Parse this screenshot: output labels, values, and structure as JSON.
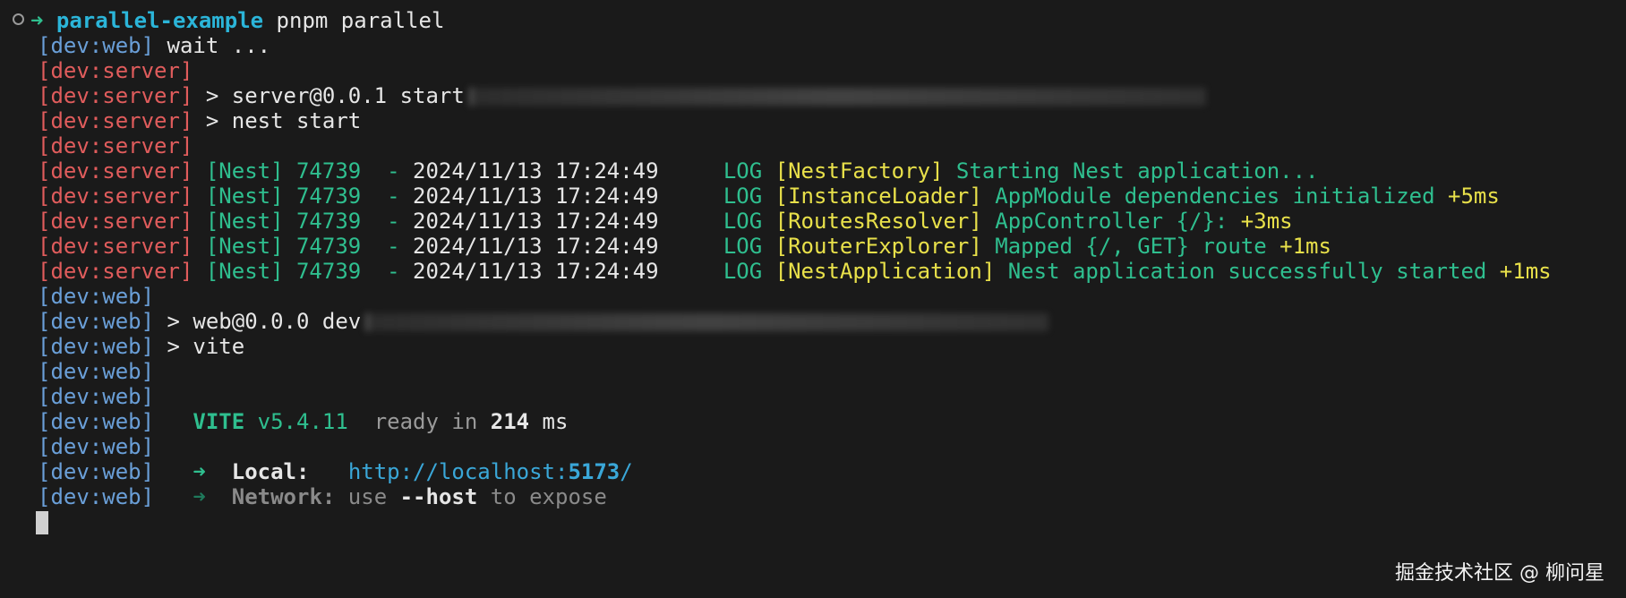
{
  "prompt": {
    "arrow": "➜",
    "dir": "parallel-example",
    "command": "pnpm parallel",
    "dir_color": "#2bb5d9",
    "arrow_color": "#2fbf8f"
  },
  "colors": {
    "web_prefix": "#6a9fd8",
    "server_prefix": "#e05c5c",
    "nest_green": "#2fbf8f",
    "context_yellow": "#e8e04a",
    "url_blue": "#3aa7d8",
    "dim": "#8a8a8a"
  },
  "lines": [
    {
      "kind": "text",
      "segments": [
        {
          "text": "[dev:web]",
          "color": "#6a9fd8"
        },
        {
          "text": " wait ...",
          "color": "#e6e6e6"
        }
      ]
    },
    {
      "kind": "text",
      "segments": [
        {
          "text": "[dev:server]",
          "color": "#e05c5c"
        }
      ]
    },
    {
      "kind": "text",
      "blur": "server",
      "segments": [
        {
          "text": "[dev:server]",
          "color": "#e05c5c"
        },
        {
          "text": " > server@0.0.1 start",
          "color": "#e6e6e6"
        }
      ]
    },
    {
      "kind": "text",
      "segments": [
        {
          "text": "[dev:server]",
          "color": "#e05c5c"
        },
        {
          "text": " > nest start",
          "color": "#e6e6e6"
        }
      ]
    },
    {
      "kind": "text",
      "segments": [
        {
          "text": "[dev:server]",
          "color": "#e05c5c"
        }
      ]
    },
    {
      "kind": "text",
      "segments": [
        {
          "text": "[dev:server]",
          "color": "#e05c5c"
        },
        {
          "text": " [Nest] 74739  - ",
          "color": "#2fbf8f"
        },
        {
          "text": "2024/11/13 17:24:49",
          "color": "#e6e6e6"
        },
        {
          "text": "     LOG ",
          "color": "#2fbf8f"
        },
        {
          "text": "[NestFactory]",
          "color": "#e8e04a"
        },
        {
          "text": " Starting Nest application...",
          "color": "#2fbf8f"
        }
      ]
    },
    {
      "kind": "text",
      "segments": [
        {
          "text": "[dev:server]",
          "color": "#e05c5c"
        },
        {
          "text": " [Nest] 74739  - ",
          "color": "#2fbf8f"
        },
        {
          "text": "2024/11/13 17:24:49",
          "color": "#e6e6e6"
        },
        {
          "text": "     LOG ",
          "color": "#2fbf8f"
        },
        {
          "text": "[InstanceLoader]",
          "color": "#e8e04a"
        },
        {
          "text": " AppModule dependencies initialized",
          "color": "#2fbf8f"
        },
        {
          "text": " +5ms",
          "color": "#e8e04a"
        }
      ]
    },
    {
      "kind": "text",
      "segments": [
        {
          "text": "[dev:server]",
          "color": "#e05c5c"
        },
        {
          "text": " [Nest] 74739  - ",
          "color": "#2fbf8f"
        },
        {
          "text": "2024/11/13 17:24:49",
          "color": "#e6e6e6"
        },
        {
          "text": "     LOG ",
          "color": "#2fbf8f"
        },
        {
          "text": "[RoutesResolver]",
          "color": "#e8e04a"
        },
        {
          "text": " AppController {/}:",
          "color": "#2fbf8f"
        },
        {
          "text": " +3ms",
          "color": "#e8e04a"
        }
      ]
    },
    {
      "kind": "text",
      "segments": [
        {
          "text": "[dev:server]",
          "color": "#e05c5c"
        },
        {
          "text": " [Nest] 74739  - ",
          "color": "#2fbf8f"
        },
        {
          "text": "2024/11/13 17:24:49",
          "color": "#e6e6e6"
        },
        {
          "text": "     LOG ",
          "color": "#2fbf8f"
        },
        {
          "text": "[RouterExplorer]",
          "color": "#e8e04a"
        },
        {
          "text": " Mapped {/, GET} route",
          "color": "#2fbf8f"
        },
        {
          "text": " +1ms",
          "color": "#e8e04a"
        }
      ]
    },
    {
      "kind": "text",
      "segments": [
        {
          "text": "[dev:server]",
          "color": "#e05c5c"
        },
        {
          "text": " [Nest] 74739  - ",
          "color": "#2fbf8f"
        },
        {
          "text": "2024/11/13 17:24:49",
          "color": "#e6e6e6"
        },
        {
          "text": "     LOG ",
          "color": "#2fbf8f"
        },
        {
          "text": "[NestApplication]",
          "color": "#e8e04a"
        },
        {
          "text": " Nest application successfully started",
          "color": "#2fbf8f"
        },
        {
          "text": " +1ms",
          "color": "#e8e04a"
        }
      ]
    },
    {
      "kind": "text",
      "segments": [
        {
          "text": "[dev:web]",
          "color": "#6a9fd8"
        }
      ]
    },
    {
      "kind": "text",
      "blur": "web",
      "segments": [
        {
          "text": "[dev:web]",
          "color": "#6a9fd8"
        },
        {
          "text": " > web@0.0.0 dev",
          "color": "#e6e6e6"
        }
      ]
    },
    {
      "kind": "text",
      "segments": [
        {
          "text": "[dev:web]",
          "color": "#6a9fd8"
        },
        {
          "text": " > vite",
          "color": "#e6e6e6"
        }
      ]
    },
    {
      "kind": "text",
      "segments": [
        {
          "text": "[dev:web]",
          "color": "#6a9fd8"
        }
      ]
    },
    {
      "kind": "text",
      "segments": [
        {
          "text": "[dev:web]",
          "color": "#6a9fd8"
        }
      ]
    },
    {
      "kind": "text",
      "segments": [
        {
          "text": "[dev:web]",
          "color": "#6a9fd8"
        },
        {
          "text": "   ",
          "color": "#e6e6e6"
        },
        {
          "text": "VITE",
          "color": "#2fbf8f",
          "bold": true
        },
        {
          "text": " v5.4.11",
          "color": "#2fbf8f"
        },
        {
          "text": "  ready in ",
          "color": "#9a9a9a"
        },
        {
          "text": "214",
          "color": "#e6e6e6",
          "bold": true
        },
        {
          "text": " ms",
          "color": "#e6e6e6"
        }
      ]
    },
    {
      "kind": "text",
      "segments": [
        {
          "text": "[dev:web]",
          "color": "#6a9fd8"
        }
      ]
    },
    {
      "kind": "text",
      "segments": [
        {
          "text": "[dev:web]",
          "color": "#6a9fd8"
        },
        {
          "text": "   ➜  ",
          "color": "#2fbf8f"
        },
        {
          "text": "Local:",
          "color": "#e6e6e6",
          "bold": true
        },
        {
          "text": "   ",
          "color": "#e6e6e6"
        },
        {
          "text": "http://localhost:",
          "color": "#3aa7d8"
        },
        {
          "text": "5173",
          "color": "#3aa7d8",
          "bold": true
        },
        {
          "text": "/",
          "color": "#3aa7d8"
        }
      ]
    },
    {
      "kind": "text",
      "segments": [
        {
          "text": "[dev:web]",
          "color": "#6a9fd8"
        },
        {
          "text": "   ➜  ",
          "color": "#1f7a5c"
        },
        {
          "text": "Network:",
          "color": "#8a8a8a",
          "bold": true
        },
        {
          "text": " use ",
          "color": "#8a8a8a"
        },
        {
          "text": "--host",
          "color": "#e6e6e6",
          "bold": true
        },
        {
          "text": " to expose",
          "color": "#8a8a8a"
        }
      ]
    }
  ],
  "watermark": "掘金技术社区 @ 柳问星"
}
